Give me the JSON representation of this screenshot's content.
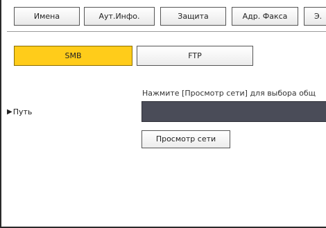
{
  "tabs": [
    {
      "label": "Имена"
    },
    {
      "label": "Аут.Инфо."
    },
    {
      "label": "Защита"
    },
    {
      "label": "Адр. Факса"
    },
    {
      "label": "Э."
    }
  ],
  "protocol": {
    "smb_label": "SMB",
    "ftp_label": "FTP",
    "selected": "SMB",
    "selected_color": "#ffcc1a"
  },
  "path": {
    "hint": "Нажмите [Просмотр сети] для выбора общ",
    "arrow": "▶",
    "label": "Путь",
    "value": "",
    "field_color": "#4a4c58"
  },
  "browse_button": {
    "label": "Просмотр сети"
  }
}
